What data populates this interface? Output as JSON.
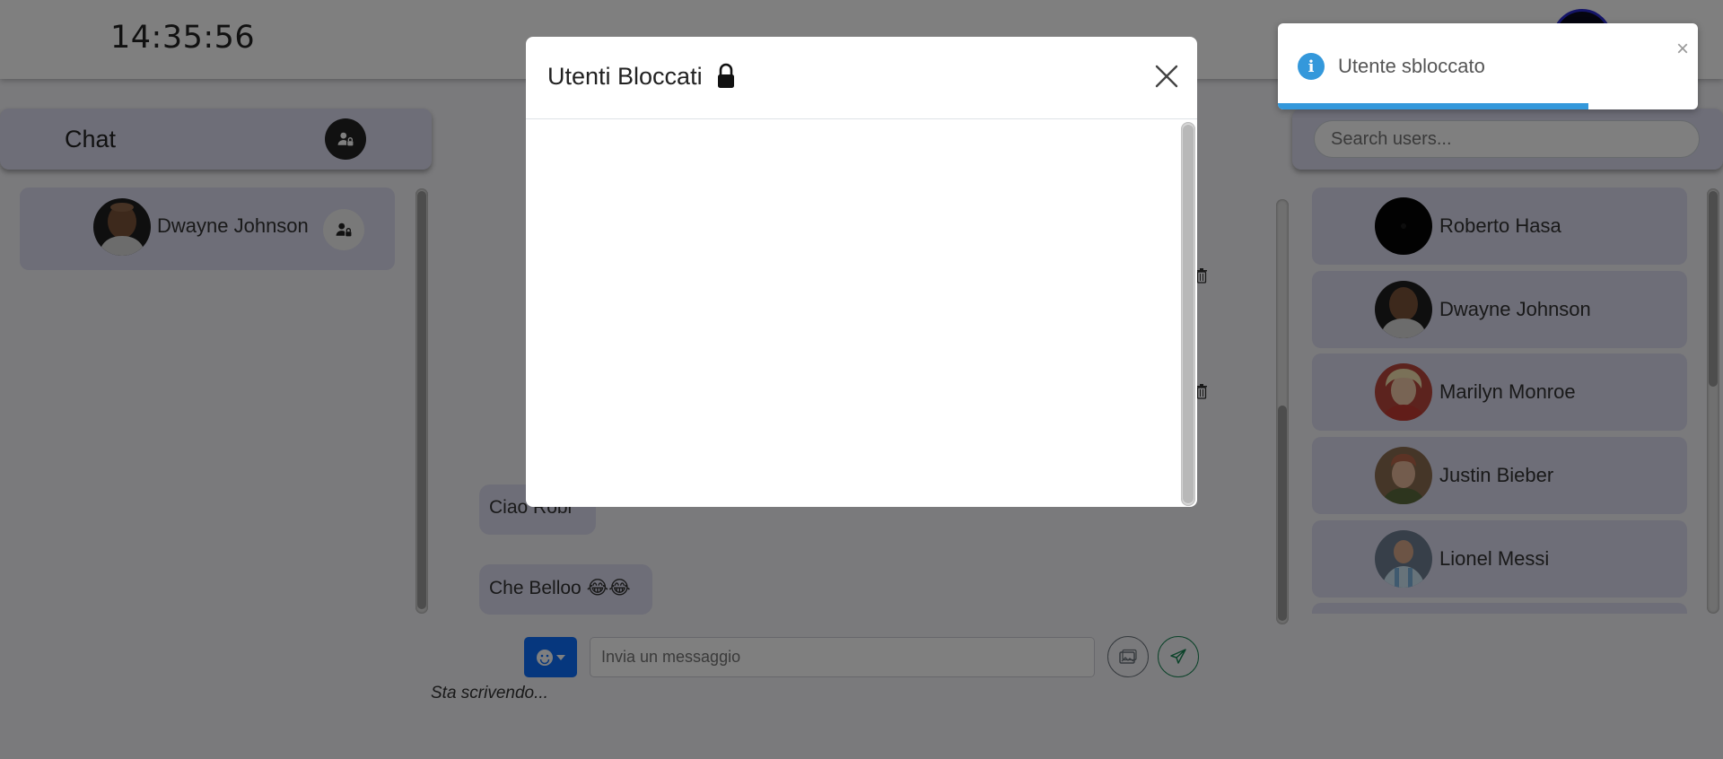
{
  "header": {
    "clock": "14:35:56"
  },
  "chat_panel": {
    "title": "Chat",
    "items": [
      {
        "name": "Dwayne Johnson"
      }
    ]
  },
  "messages": [
    {
      "text": "Ciao Robi"
    },
    {
      "text": "Che Belloo 😂😂"
    }
  ],
  "composer": {
    "placeholder": "Invia un messaggio",
    "typing_indicator": "Sta scrivendo..."
  },
  "users_panel": {
    "search_placeholder": "Search users...",
    "users": [
      {
        "name": "Roberto Hasa"
      },
      {
        "name": "Dwayne Johnson"
      },
      {
        "name": "Marilyn Monroe"
      },
      {
        "name": "Justin Bieber"
      },
      {
        "name": "Lionel Messi"
      }
    ]
  },
  "modal": {
    "title": "Utenti Bloccati",
    "title_icon": "lock-icon",
    "blocked_users": []
  },
  "toast": {
    "message": "Utente sbloccato",
    "close_glyph": "×",
    "icon_glyph": "i",
    "progress_fraction": 0.74
  },
  "colors": {
    "accent": "#0d6efd",
    "toast_info": "#3498db",
    "panel": "#dcdcf0"
  }
}
